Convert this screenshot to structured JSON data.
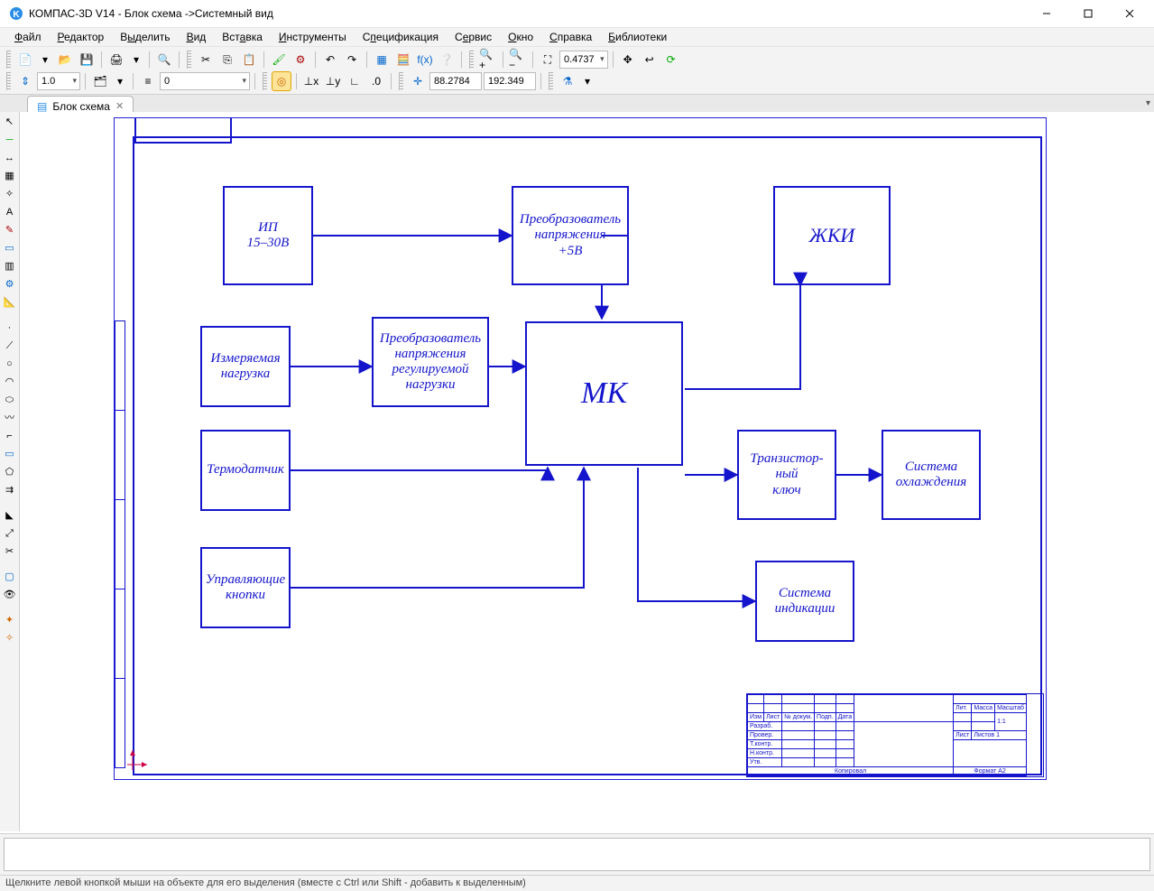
{
  "title": "КОМПАС-3D V14 - Блок схема ->Системный вид",
  "menu": [
    "Файл",
    "Редактор",
    "Выделить",
    "Вид",
    "Вставка",
    "Инструменты",
    "Спецификация",
    "Сервис",
    "Окно",
    "Справка",
    "Библиотеки"
  ],
  "toolbar1": {
    "zoom": "0.4737"
  },
  "toolbar2": {
    "scale": "1.0",
    "style": "0",
    "coord_x": "88.2784",
    "coord_y": "192.349"
  },
  "tab": {
    "label": "Блок схема"
  },
  "diagram": {
    "blocks": {
      "psu": {
        "text": "ИП\n15–30В"
      },
      "conv5v": {
        "text": "Преобразователь\nнапряжения\n+5В"
      },
      "lcd": {
        "text": "ЖКИ"
      },
      "load": {
        "text": "Измеряемая\nнагрузка"
      },
      "convload": {
        "text": "Преобразователь\nнапряжения\nрегулируемой\nнагрузки"
      },
      "mcu": {
        "text": "МК"
      },
      "thermo": {
        "text": "Термодатчик"
      },
      "tkey": {
        "text": "Транзистор-\nный\nключ"
      },
      "cooling": {
        "text": "Система\nохлаждения"
      },
      "buttons": {
        "text": "Управляющие\nкнопки"
      },
      "indication": {
        "text": "Система\nиндикации"
      }
    },
    "stamp": {
      "cols": [
        "Изм",
        "Лист",
        "№ докум.",
        "Подп.",
        "Дата"
      ],
      "rows": [
        "Разраб.",
        "Провер.",
        "Т.контр.",
        "",
        "Н.контр.",
        "Утв."
      ],
      "lit": "Лит.",
      "mass": "Масса",
      "scale_lbl": "Масштаб",
      "scale": "1:1",
      "sheet": "Лист",
      "sheets": "Листов 1",
      "copied": "Копировал",
      "format": "Формат   A2"
    }
  },
  "status": "Щелкните левой кнопкой мыши на объекте для его выделения (вместе с Ctrl или Shift - добавить к выделенным)"
}
